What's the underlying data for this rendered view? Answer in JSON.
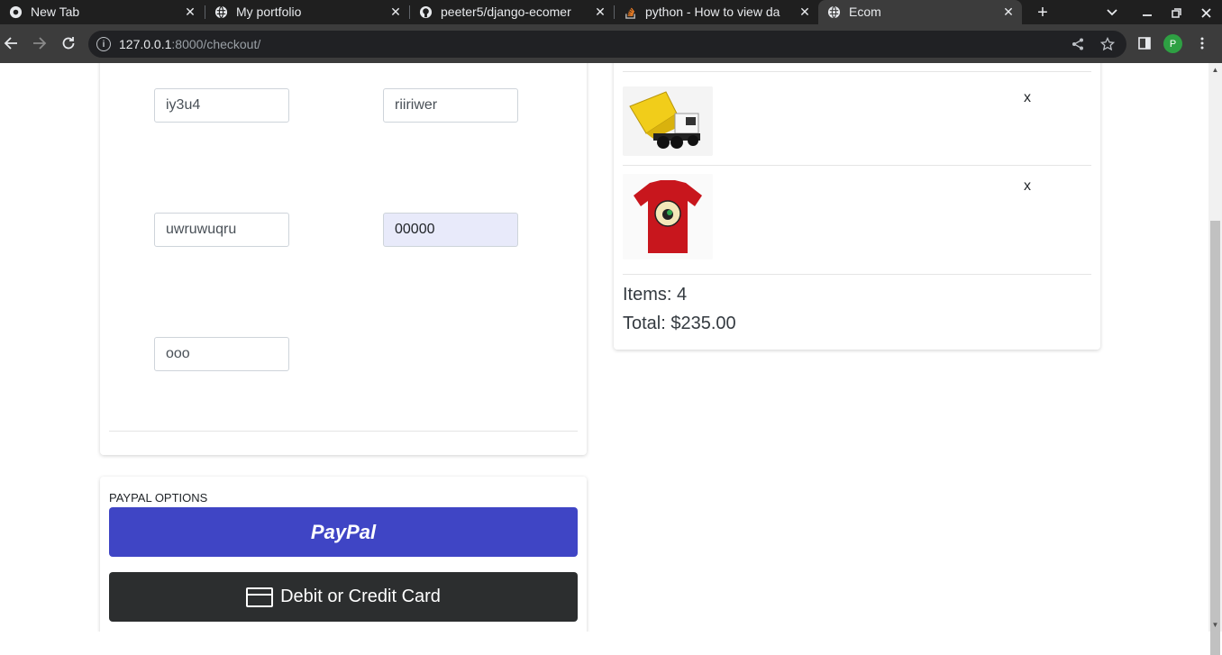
{
  "browser": {
    "tabs": [
      {
        "title": "New Tab",
        "icon": "chrome-icon",
        "active": false
      },
      {
        "title": "My portfolio",
        "icon": "globe-icon",
        "active": false
      },
      {
        "title": "peeter5/django-ecomer",
        "icon": "github-icon",
        "active": false
      },
      {
        "title": "python - How to view da",
        "icon": "stackoverflow-icon",
        "active": false
      },
      {
        "title": "Ecom",
        "icon": "globe-icon",
        "active": true
      }
    ],
    "url_host": "127.0.0.1",
    "url_rest": ":8000/checkout/",
    "profile_initial": "P"
  },
  "form": {
    "fields": [
      {
        "value": "iy3u4"
      },
      {
        "value": "riiriwer"
      },
      {
        "value": "uwruwuqru"
      },
      {
        "value": "00000"
      },
      {
        "value": "ooo"
      }
    ]
  },
  "paypal": {
    "label": "PAYPAL OPTIONS",
    "paypal_button": "PayPal",
    "card_button": "Debit or Credit Card"
  },
  "summary": {
    "items": [
      {
        "image": "toy-dump-truck",
        "qty_mark": "x"
      },
      {
        "image": "red-tshirt",
        "qty_mark": "x"
      }
    ],
    "items_text": "Items: 4",
    "total_text": "Total: $235.00"
  },
  "colors": {
    "paypal_blue": "#3f45c5",
    "card_dark": "#2c2e2f",
    "autofill_bg": "#e8eafa"
  }
}
